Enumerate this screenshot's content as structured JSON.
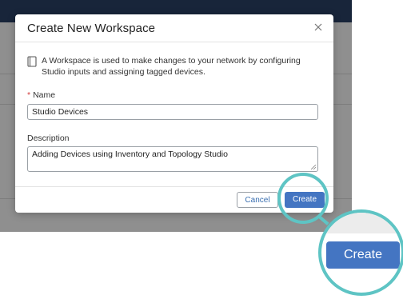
{
  "modal": {
    "title": "Create New Workspace",
    "info_text": "A Workspace is used to make changes to your network by configuring Studio inputs and assigning tagged devices.",
    "name_label": "Name",
    "name_required_marker": "*",
    "name_value": "Studio Devices",
    "description_label": "Description",
    "description_value": "Adding Devices using Inventory and Topology Studio",
    "cancel_label": "Cancel",
    "create_label": "Create"
  },
  "zoom": {
    "create_label": "Create"
  },
  "colors": {
    "accent": "#4475c2",
    "highlight_ring": "#5ec4c4",
    "topbar": "#18253a"
  },
  "icons": [
    "close-icon",
    "document-icon",
    "resize-handle-icon"
  ]
}
